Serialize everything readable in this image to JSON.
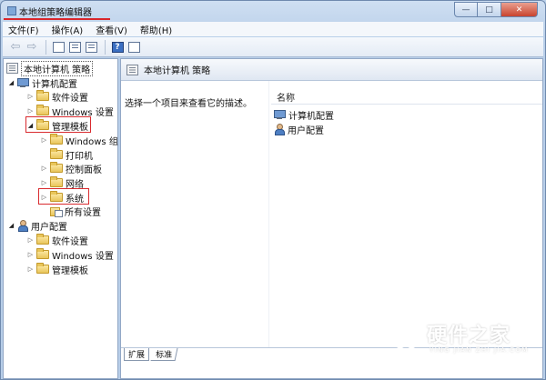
{
  "window": {
    "title": "本地组策略编辑器",
    "minimize": "—",
    "maximize": "□",
    "close": "✕"
  },
  "menubar": {
    "items": [
      "文件(F)",
      "操作(A)",
      "查看(V)",
      "帮助(H)"
    ]
  },
  "toolbar": {
    "buttons": [
      "back-arrow-icon",
      "forward-arrow-icon",
      "show-hide-tree-icon",
      "properties-icon",
      "export-list-icon",
      "help-icon",
      "view-icon"
    ],
    "help_glyph": "?",
    "back_glyph": "⇦",
    "forward_glyph": "⇨"
  },
  "tree": {
    "root": "本地计算机 策略",
    "computer_config": "计算机配置",
    "cc_software": "软件设置",
    "cc_windows": "Windows 设置",
    "cc_admin": "管理模板",
    "admin_windows_components": "Windows 组",
    "admin_printers": "打印机",
    "admin_control_panel": "控制面板",
    "admin_network": "网络",
    "admin_system": "系统",
    "admin_all_settings": "所有设置",
    "user_config": "用户配置",
    "uc_software": "软件设置",
    "uc_windows": "Windows 设置",
    "uc_admin": "管理模板"
  },
  "content": {
    "title": "本地计算机 策略",
    "description": "选择一个项目来查看它的描述。",
    "column_name": "名称",
    "items": [
      "计算机配置",
      "用户配置"
    ]
  },
  "tabs": {
    "extended": "扩展",
    "standard": "标准"
  },
  "watermark": {
    "text": "硬件之家",
    "subtext": "YING JIAN ZHI JIA.COM"
  },
  "colors": {
    "highlight_red": "#d92b2f",
    "frame_blue": "#b9cfe9"
  }
}
